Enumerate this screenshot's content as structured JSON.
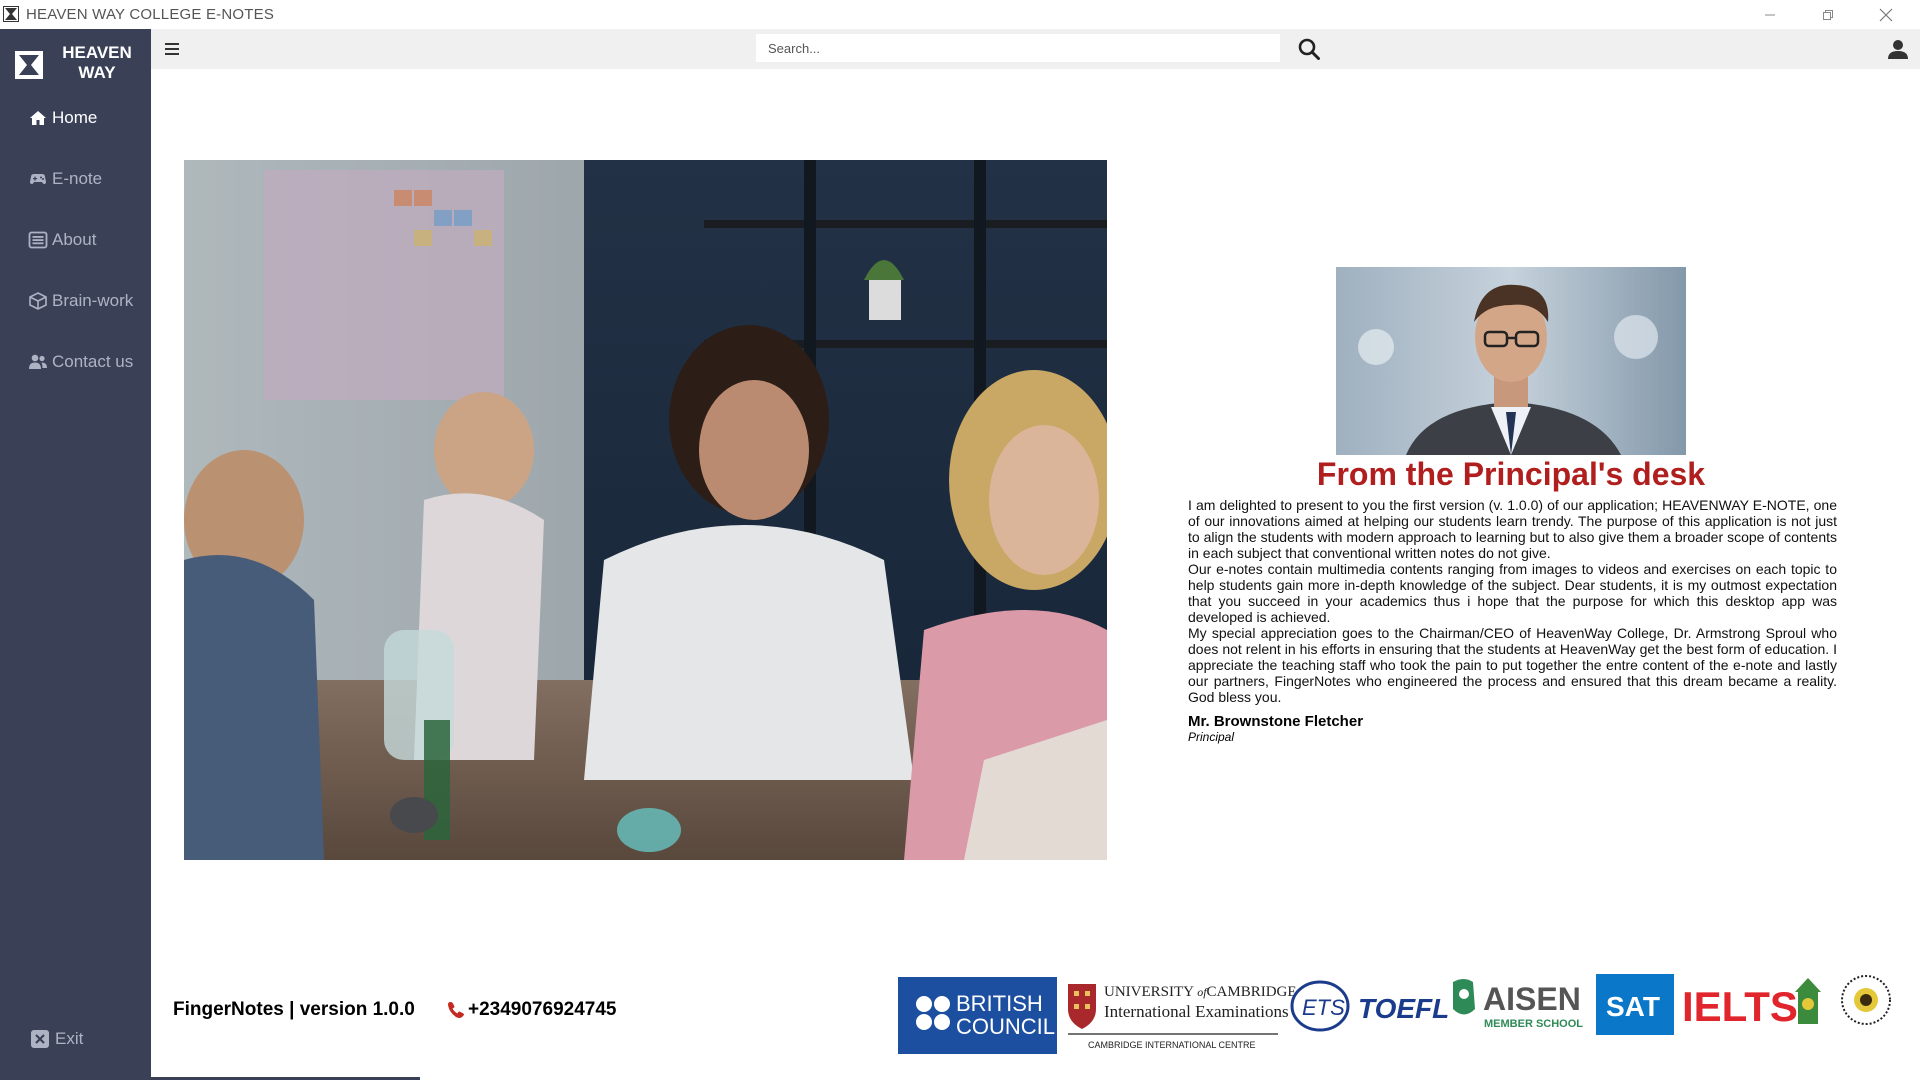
{
  "window": {
    "title": "HEAVEN WAY COLLEGE E-NOTES"
  },
  "sidebar": {
    "brand": "HEAVEN WAY",
    "items": [
      {
        "label": "Home",
        "icon": "home-icon",
        "active": true
      },
      {
        "label": "E-note",
        "icon": "gamepad-icon",
        "active": false
      },
      {
        "label": "About",
        "icon": "list-icon",
        "active": false
      },
      {
        "label": "Brain-work",
        "icon": "cube-icon",
        "active": false
      },
      {
        "label": "Contact us",
        "icon": "users-icon",
        "active": false
      }
    ],
    "exit_label": "Exit"
  },
  "toolbar": {
    "search_placeholder": "Search..."
  },
  "principal": {
    "title": "From the Principal's desk",
    "paragraphs": [
      "I am delighted to present to you the first version (v. 1.0.0) of our application; HEAVENWAY E-NOTE, one of our innovations aimed at helping our students learn trendy. The purpose of this application is not just to align the students with modern approach to learning but to also give them a broader scope of contents in each subject that conventional written notes do not give.",
      "Our e-notes contain multimedia contents ranging from images to videos and exercises on each topic to help students gain more in-depth knowledge of the subject. Dear students, it is my outmost expectation that you succeed in your academics thus i hope that the purpose for which this desktop app was developed is achieved.",
      "My special appreciation goes to the Chairman/CEO of HeavenWay College, Dr. Armstrong Sproul who does not relent in his efforts in ensuring that the students at HeavenWay get the best form of education. I appreciate the teaching staff who took the pain to put together the entre content of the e-note and lastly our partners, FingerNotes who engineered the process and ensured that this dream became a reality. God bless you."
    ],
    "signer_name": "Mr. Brownstone Fletcher",
    "signer_role": "Principal"
  },
  "footer": {
    "version_text": "FingerNotes | version 1.0.0",
    "phone": "+2349076924745"
  },
  "partners": {
    "british_council": [
      "BRITISH",
      "COUNCIL"
    ],
    "cambridge": [
      "UNIVERSITY",
      "of",
      "CAMBRIDGE",
      "International Examinations",
      "CAMBRIDGE INTERNATIONAL CENTRE"
    ],
    "ets": "ETS",
    "toefl": "TOEFL",
    "aisen": [
      "AISEN",
      "MEMBER SCHOOL"
    ],
    "sat": "SAT",
    "ielts": "IELTS"
  },
  "colors": {
    "sidebar_bg": "#3a4157",
    "accent_title": "#b01e1e",
    "toolbar_bg": "#f0f0f0",
    "british_council_blue": "#1c4fa0",
    "ielts_red": "#e0252c",
    "sat_blue": "#0a77c9",
    "aisen_green": "#2e8b57"
  }
}
